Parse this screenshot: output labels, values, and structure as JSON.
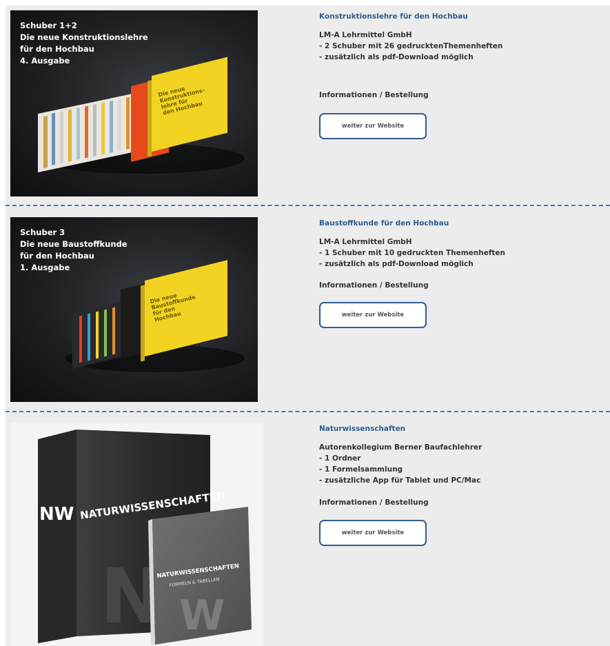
{
  "products": [
    {
      "cover_lines": [
        "Schuber 1+2",
        "Die neue Konstruktionslehre",
        "für den Hochbau",
        "4. Ausgabe"
      ],
      "book_cover_text": [
        "Die neue",
        "Konstruktions-",
        "lehre für",
        "den Hochbau"
      ],
      "title": "Konstruktionslehre für den Hochbau",
      "lines": [
        "LM-A Lehrmittel GmbH",
        "- 2 Schuber mit 26 gedrucktenThemenheften",
        "- zusätzlich als pdf-Download möglich"
      ],
      "info_label": "Informationen / Bestellung",
      "button_label": "weiter zur Website"
    },
    {
      "cover_lines": [
        "Schuber 3",
        "Die neue Baustoffkunde",
        "für den Hochbau",
        "1. Ausgabe"
      ],
      "book_cover_text": [
        "Die neue",
        "Baustoffkunde",
        "für den",
        "Hochbau"
      ],
      "title": "Baustoffkunde für den Hochbau",
      "lines": [
        "LM-A Lehrmittel GmbH",
        "- 1 Schuber mit 10 gedruckten Themenheften",
        "- zusätzlich als pdf-Download möglich"
      ],
      "info_label": "Informationen / Bestellung",
      "button_label": "weiter zur Website"
    },
    {
      "binder_text": "NATURWISSENSCHAFTEN",
      "binder_monogram": "NW",
      "booklet_title": "NATURWISSENSCHAFTEN",
      "booklet_subtitle": "FORMELN & TABELLEN",
      "title": "Naturwissenschaften",
      "lines": [
        "Autorenkollegium Berner Baufachlehrer",
        "- 1 Ordner",
        "- 1 Formelsammlung",
        "- zusätzliche App für Tablet und PC/Mac"
      ],
      "info_label": "Informationen / Bestellung",
      "button_label": "weiter zur Website"
    }
  ],
  "colors": {
    "accent": "#2f5e8c",
    "divider": "#3f7ab8",
    "background": "#ececec"
  }
}
